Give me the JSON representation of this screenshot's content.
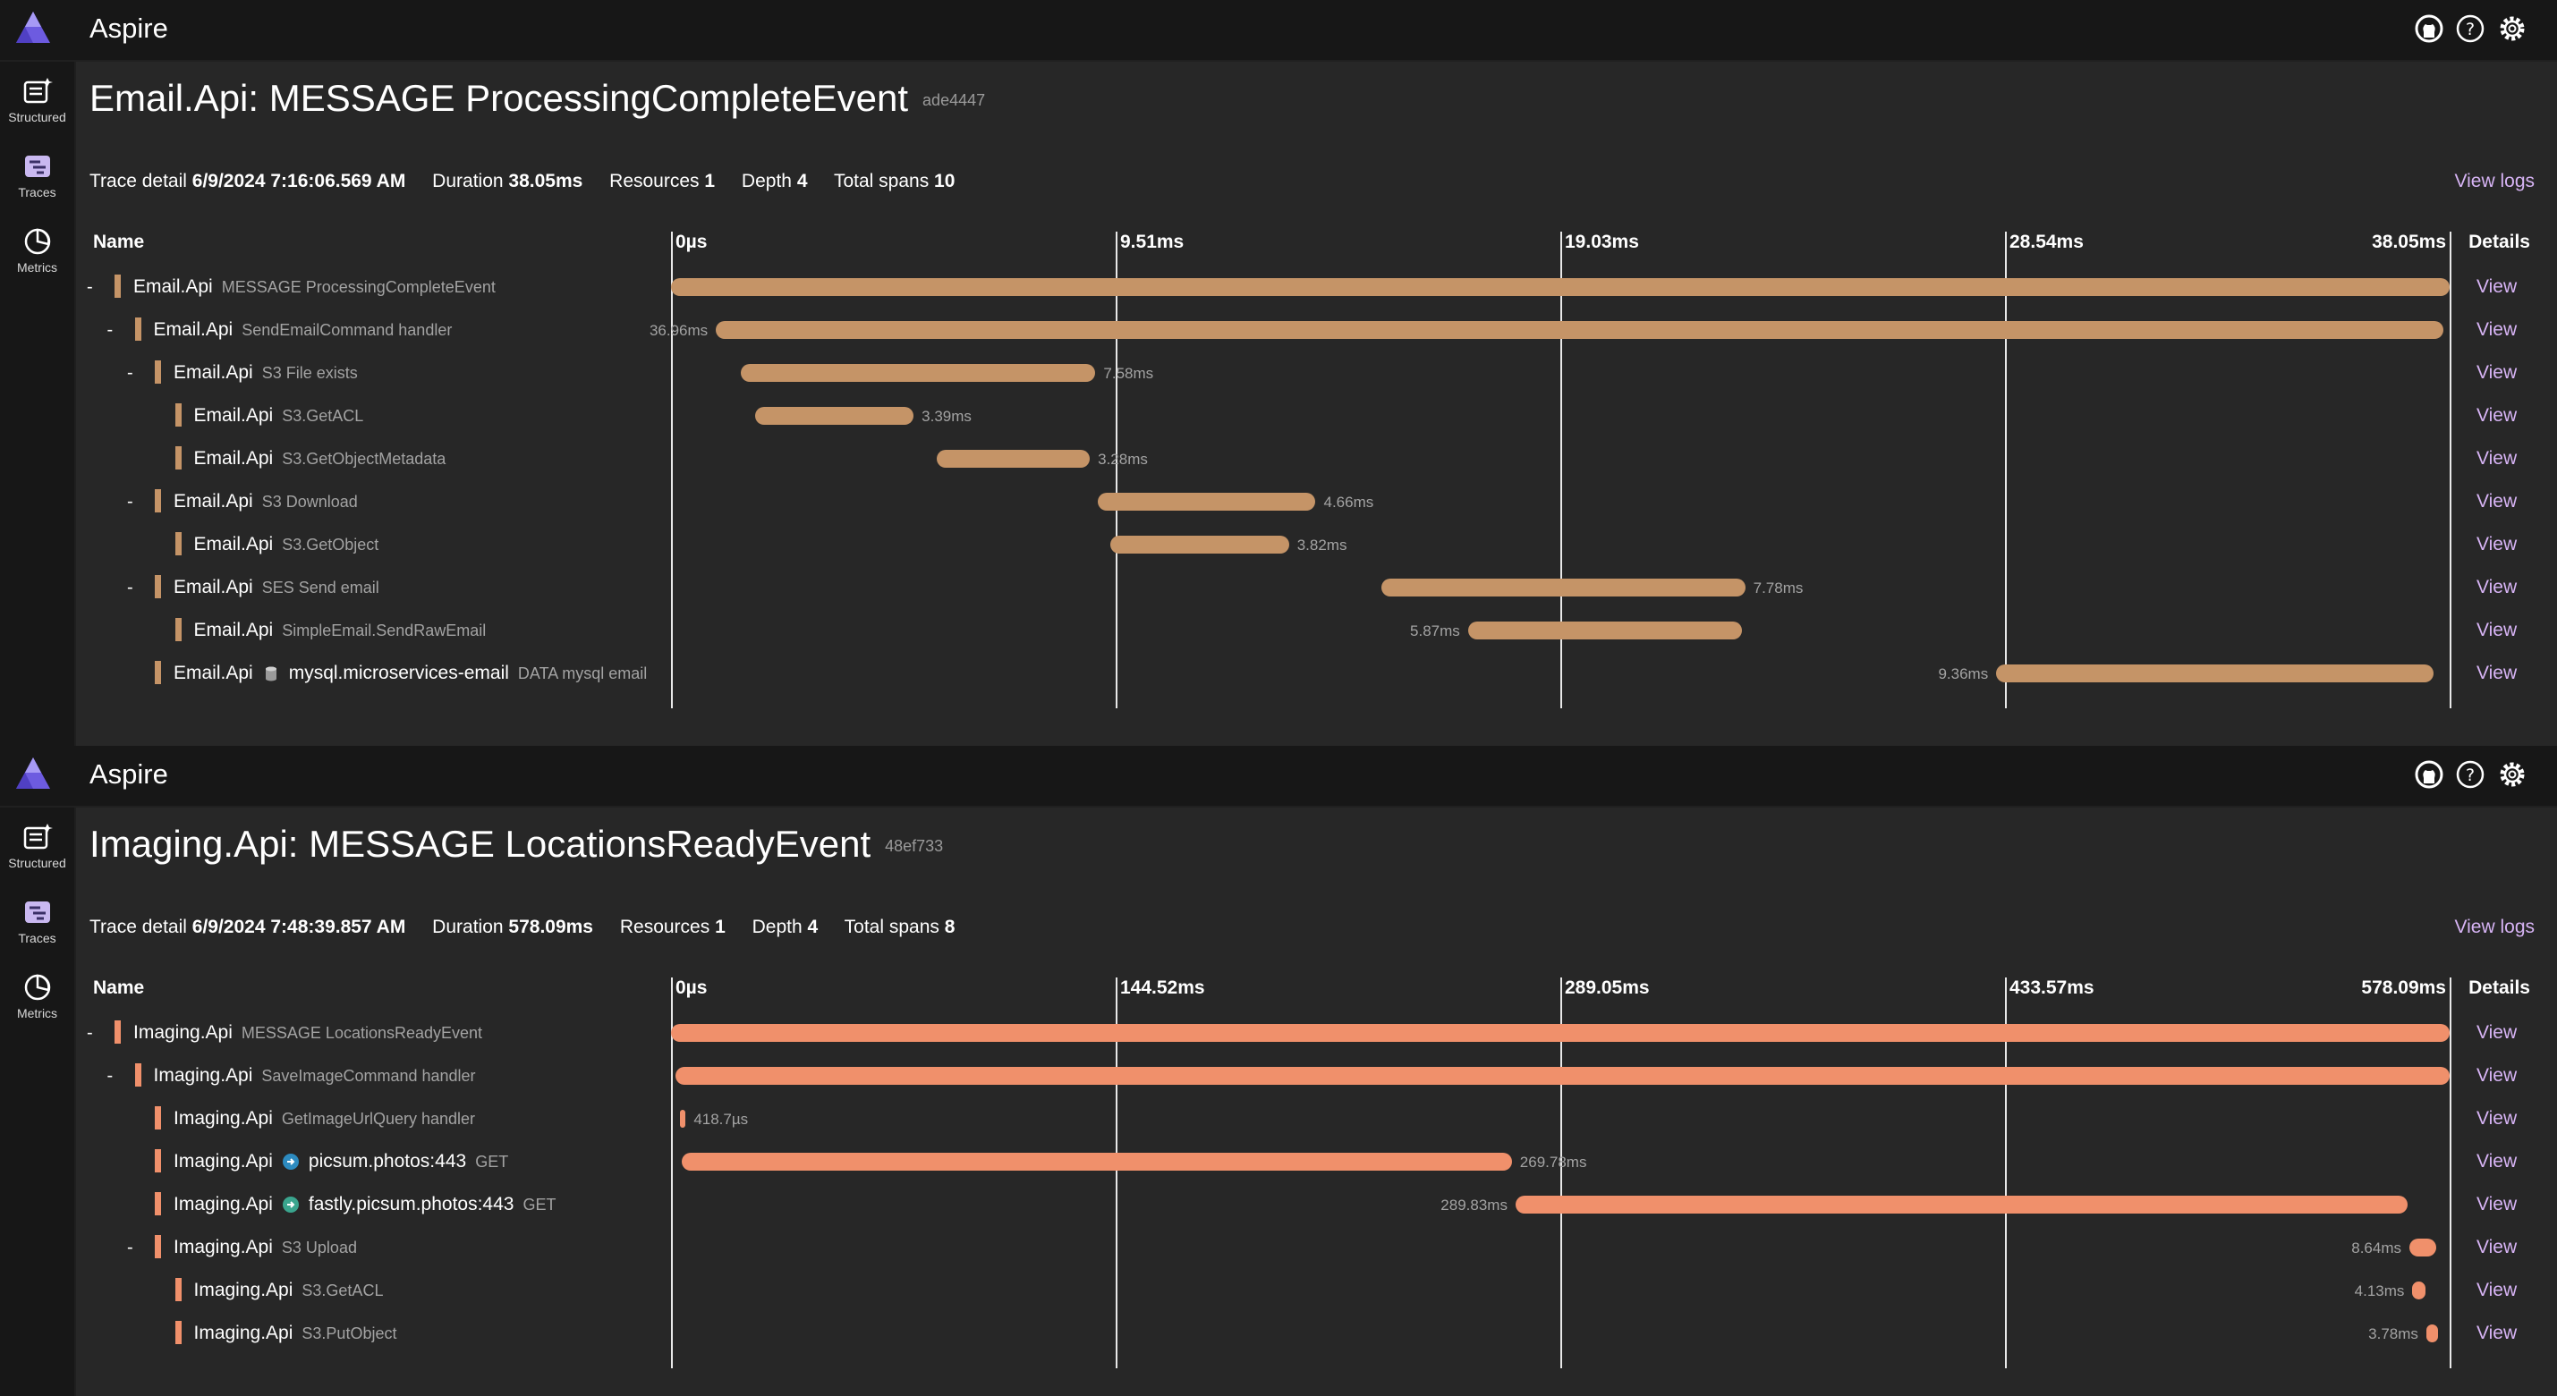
{
  "app": {
    "title": "Aspire"
  },
  "nav": {
    "structured": "Structured",
    "traces": "Traces",
    "metrics": "Metrics"
  },
  "panels": [
    {
      "title": "Email.Api: MESSAGE ProcessingCompleteEvent",
      "trace_id": "ade4447",
      "summary": {
        "trace_detail_label": "Trace detail",
        "trace_detail": "6/9/2024 7:16:06.569 AM",
        "duration_label": "Duration",
        "duration": "38.05ms",
        "resources_label": "Resources",
        "resources": "1",
        "depth_label": "Depth",
        "depth": "4",
        "spans_label": "Total spans",
        "spans": "10"
      },
      "view_logs": "View logs",
      "columns": {
        "name": "Name",
        "details": "Details",
        "ticks": [
          "0µs",
          "9.51ms",
          "19.03ms",
          "28.54ms",
          "38.05ms"
        ]
      },
      "bar_color": "#c59467",
      "rows": [
        {
          "indent": 0,
          "collapse": "-",
          "service": "Email.Api",
          "name": "MESSAGE ProcessingCompleteEvent",
          "kind": "",
          "icon": "",
          "start_ms": 0,
          "duration_ms": 38.05,
          "duration_label": "",
          "label_side": "none",
          "view": "View"
        },
        {
          "indent": 1,
          "collapse": "-",
          "service": "Email.Api",
          "name": "SendEmailCommand handler",
          "kind": "",
          "icon": "",
          "start_ms": 0.96,
          "duration_ms": 36.96,
          "duration_label": "36.96ms",
          "label_side": "left",
          "view": "View"
        },
        {
          "indent": 2,
          "collapse": "-",
          "service": "Email.Api",
          "name": "S3 File exists",
          "kind": "",
          "icon": "",
          "start_ms": 1.5,
          "duration_ms": 7.58,
          "duration_label": "7.58ms",
          "label_side": "right",
          "view": "View"
        },
        {
          "indent": 3,
          "collapse": "",
          "service": "Email.Api",
          "name": "S3.GetACL",
          "kind": "",
          "icon": "",
          "start_ms": 1.8,
          "duration_ms": 3.39,
          "duration_label": "3.39ms",
          "label_side": "right",
          "view": "View"
        },
        {
          "indent": 3,
          "collapse": "",
          "service": "Email.Api",
          "name": "S3.GetObjectMetadata",
          "kind": "",
          "icon": "",
          "start_ms": 5.68,
          "duration_ms": 3.28,
          "duration_label": "3.28ms",
          "label_side": "right",
          "view": "View"
        },
        {
          "indent": 2,
          "collapse": "-",
          "service": "Email.Api",
          "name": "S3 Download",
          "kind": "",
          "icon": "",
          "start_ms": 9.13,
          "duration_ms": 4.66,
          "duration_label": "4.66ms",
          "label_side": "right",
          "view": "View"
        },
        {
          "indent": 3,
          "collapse": "",
          "service": "Email.Api",
          "name": "S3.GetObject",
          "kind": "",
          "icon": "",
          "start_ms": 9.4,
          "duration_ms": 3.82,
          "duration_label": "3.82ms",
          "label_side": "right",
          "view": "View"
        },
        {
          "indent": 2,
          "collapse": "-",
          "service": "Email.Api",
          "name": "SES Send email",
          "kind": "",
          "icon": "",
          "start_ms": 15.2,
          "duration_ms": 7.78,
          "duration_label": "7.78ms",
          "label_side": "right",
          "view": "View"
        },
        {
          "indent": 3,
          "collapse": "",
          "service": "Email.Api",
          "name": "SimpleEmail.SendRawEmail",
          "kind": "",
          "icon": "",
          "start_ms": 17.05,
          "duration_ms": 5.87,
          "duration_label": "5.87ms",
          "label_side": "left",
          "view": "View"
        },
        {
          "indent": 2,
          "collapse": "",
          "service": "Email.Api",
          "name": "mysql.microservices-email",
          "kind": "DATA mysql email",
          "icon": "database-icon",
          "start_ms": 28.35,
          "duration_ms": 9.36,
          "duration_label": "9.36ms",
          "label_side": "left",
          "view": "View"
        }
      ]
    },
    {
      "title": "Imaging.Api: MESSAGE LocationsReadyEvent",
      "trace_id": "48ef733",
      "summary": {
        "trace_detail_label": "Trace detail",
        "trace_detail": "6/9/2024 7:48:39.857 AM",
        "duration_label": "Duration",
        "duration": "578.09ms",
        "resources_label": "Resources",
        "resources": "1",
        "depth_label": "Depth",
        "depth": "4",
        "spans_label": "Total spans",
        "spans": "8"
      },
      "view_logs": "View logs",
      "columns": {
        "name": "Name",
        "details": "Details",
        "ticks": [
          "0µs",
          "144.52ms",
          "289.05ms",
          "433.57ms",
          "578.09ms"
        ]
      },
      "bar_color": "#f0906b",
      "rows": [
        {
          "indent": 0,
          "collapse": "-",
          "service": "Imaging.Api",
          "name": "MESSAGE LocationsReadyEvent",
          "kind": "",
          "icon": "",
          "start_ms": 0,
          "duration_ms": 578.09,
          "duration_label": "",
          "label_side": "none",
          "view": "View"
        },
        {
          "indent": 1,
          "collapse": "-",
          "service": "Imaging.Api",
          "name": "SaveImageCommand handler",
          "kind": "",
          "icon": "",
          "start_ms": 1.5,
          "duration_ms": 576.5,
          "duration_label": "",
          "label_side": "none",
          "view": "View"
        },
        {
          "indent": 2,
          "collapse": "",
          "service": "Imaging.Api",
          "name": "GetImageUrlQuery handler",
          "kind": "",
          "icon": "",
          "start_ms": 3.0,
          "duration_ms": 0.4187,
          "duration_label": "418.7µs",
          "label_side": "right",
          "view": "View"
        },
        {
          "indent": 2,
          "collapse": "",
          "service": "Imaging.Api",
          "name": "picsum.photos:443",
          "kind": "GET",
          "icon": "http-icon",
          "start_ms": 3.5,
          "duration_ms": 269.78,
          "duration_label": "269.78ms",
          "label_side": "right",
          "view": "View"
        },
        {
          "indent": 2,
          "collapse": "",
          "service": "Imaging.Api",
          "name": "fastly.picsum.photos:443",
          "kind": "GET",
          "icon": "http-icon",
          "start_ms": 274.5,
          "duration_ms": 289.83,
          "duration_label": "289.83ms",
          "label_side": "left",
          "view": "View"
        },
        {
          "indent": 2,
          "collapse": "-",
          "service": "Imaging.Api",
          "name": "S3 Upload",
          "kind": "",
          "icon": "",
          "start_ms": 565.0,
          "duration_ms": 8.64,
          "duration_label": "8.64ms",
          "label_side": "left",
          "view": "View"
        },
        {
          "indent": 3,
          "collapse": "",
          "service": "Imaging.Api",
          "name": "S3.GetACL",
          "kind": "",
          "icon": "",
          "start_ms": 566.0,
          "duration_ms": 4.13,
          "duration_label": "4.13ms",
          "label_side": "left",
          "view": "View"
        },
        {
          "indent": 3,
          "collapse": "",
          "service": "Imaging.Api",
          "name": "S3.PutObject",
          "kind": "",
          "icon": "",
          "start_ms": 570.5,
          "duration_ms": 3.78,
          "duration_label": "3.78ms",
          "label_side": "left",
          "view": "View"
        }
      ]
    }
  ]
}
